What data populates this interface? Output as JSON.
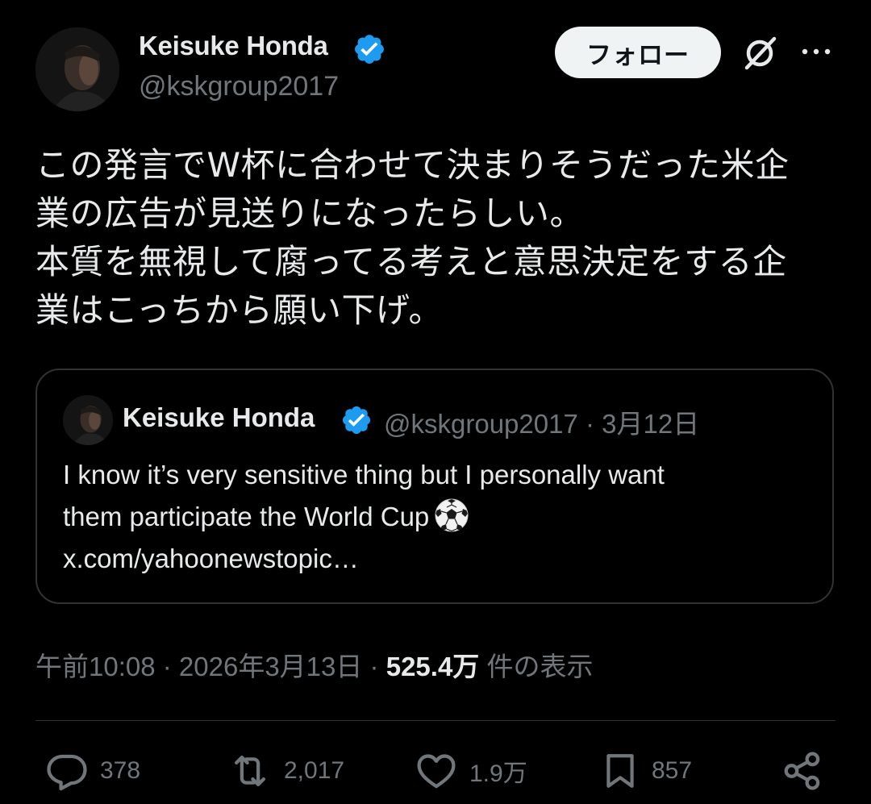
{
  "author": {
    "name": "Keisuke Honda",
    "handle": "@kskgroup2017"
  },
  "header": {
    "follow_label": "フォロー"
  },
  "tweet": {
    "lines": [
      "この発言でW杯に合わせて決まりそうだった米企",
      "業の広告が見送りになったらしい。",
      "本質を無視して腐ってる考えと意思決定をする企",
      "業はこっちから願い下げ。"
    ]
  },
  "quote": {
    "name": "Keisuke Honda",
    "meta": "@kskgroup2017 · 3月12日",
    "lines": [
      "I know it’s very sensitive thing but I personally want",
      "them participate the World Cup",
      "x.com/yahoonewstopic…"
    ]
  },
  "meta": {
    "time_date": "午前10:08 · 2026年3月13日 · ",
    "views_count": "525.4万",
    "views_label": " 件の表示"
  },
  "actions": {
    "replies": "378",
    "reposts": "2,017",
    "likes": "1.9万",
    "bookmarks": "857"
  },
  "colors": {
    "background": "#000000",
    "text_primary": "#e7e9ea",
    "text_secondary": "#71767b",
    "verified": "#1d9bf0",
    "border": "#2f3336",
    "follow_bg": "#eff3f4"
  },
  "icons": [
    "verified-badge-icon",
    "grok-icon",
    "more-icon",
    "soccer-ball-icon",
    "reply-icon",
    "repost-icon",
    "like-icon",
    "bookmark-icon",
    "share-icon"
  ]
}
